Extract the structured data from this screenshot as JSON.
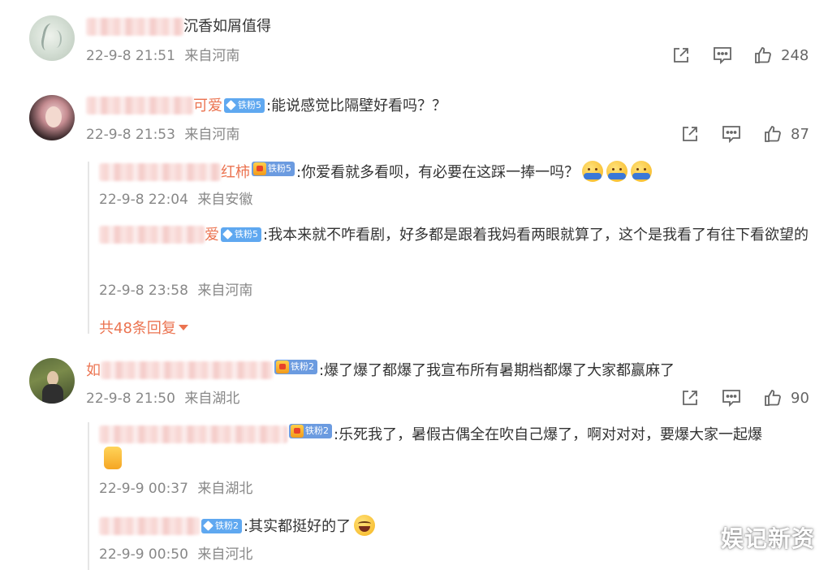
{
  "comments": [
    {
      "content": "沉香如屑值得",
      "time": "22-9-8 21:51",
      "location": "来自河南",
      "likes": "248",
      "replies": []
    },
    {
      "nick_tail": "可爱",
      "badge": "铁粉5",
      "content": ":能说感觉比隔壁好看吗？？",
      "time": "22-9-8 21:53",
      "location": "来自河南",
      "likes": "87",
      "replies": [
        {
          "nick_tail": "红柿",
          "badge": "铁粉5",
          "content": ":你爱看就多看呗，有必要在这踩一捧一吗？",
          "time": "22-9-8 22:04",
          "location": "来自安徽"
        },
        {
          "nick_tail": "爱",
          "badge": "铁粉5",
          "content": ":我本来就不咋看剧，好多都是跟着我妈看两眼就算了，这个是我看了有往下看欲望的",
          "time": "22-9-8 23:58",
          "location": "来自河南"
        }
      ],
      "more_replies": "共48条回复"
    },
    {
      "nick_head": "如",
      "badge": "铁粉2",
      "content": ":爆了爆了都爆了我宣布所有暑期档都爆了大家都赢麻了",
      "time": "22-9-8 21:50",
      "location": "来自湖北",
      "likes": "90",
      "replies": [
        {
          "badge": "铁粉2",
          "content": ":乐死我了，暑假古偶全在吹自己爆了，啊对对对，要爆大家一起爆",
          "time": "22-9-9 00:37",
          "location": "来自湖北"
        },
        {
          "badge": "铁粉2",
          "content": ":其实都挺好的了",
          "time": "22-9-9 00:50",
          "location": "来自河北"
        }
      ]
    }
  ],
  "icons": {
    "share": "share-icon",
    "comment": "comment-icon",
    "like": "thumbs-up-icon",
    "emoji_hug": "hug-emoji",
    "emoji_thumb": "thumbs-up-emoji",
    "emoji_laugh": "laughing-emoji"
  },
  "colors": {
    "accent": "#eb7350",
    "meta_text": "#888888",
    "badge_blue": "#5fa8f0"
  },
  "watermark": "娱记新资"
}
